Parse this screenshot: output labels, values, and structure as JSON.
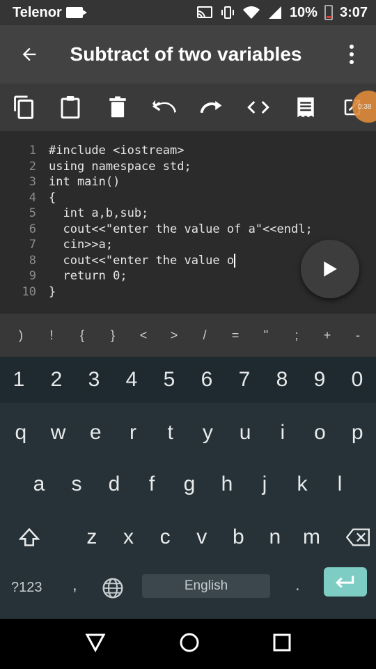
{
  "status_bar": {
    "carrier": "Telenor",
    "battery": "10%",
    "time": "3:07"
  },
  "app_bar": {
    "title": "Subtract of two variables"
  },
  "toolbar": {
    "icons": [
      "copy-icon",
      "paste-icon",
      "delete-icon",
      "undo-icon",
      "redo-icon",
      "code-icon",
      "format-icon",
      "open-external-icon"
    ],
    "overlay_badge": "0:38"
  },
  "editor": {
    "lines": [
      {
        "num": "1",
        "code": "#include <iostream>"
      },
      {
        "num": "2",
        "code": "using namespace std;"
      },
      {
        "num": "3",
        "code": "int main()"
      },
      {
        "num": "4",
        "code": "{"
      },
      {
        "num": "5",
        "code": "  int a,b,sub;"
      },
      {
        "num": "6",
        "code": "  cout<<\"enter the value of a\"<<endl;"
      },
      {
        "num": "7",
        "code": "  cin>>a;"
      },
      {
        "num": "8",
        "code": "  cout<<\"enter the value o"
      },
      {
        "num": "9",
        "code": "  return 0;"
      },
      {
        "num": "10",
        "code": "}"
      }
    ]
  },
  "symbols": [
    ")",
    "!",
    "{",
    "}",
    "<",
    ">",
    "/",
    "=",
    "\"",
    ";",
    "+",
    "-"
  ],
  "keyboard": {
    "numbers": [
      "1",
      "2",
      "3",
      "4",
      "5",
      "6",
      "7",
      "8",
      "9",
      "0"
    ],
    "row1": [
      "q",
      "w",
      "e",
      "r",
      "t",
      "y",
      "u",
      "i",
      "o",
      "p"
    ],
    "row2": [
      "a",
      "s",
      "d",
      "f",
      "g",
      "h",
      "j",
      "k",
      "l"
    ],
    "row3": [
      "z",
      "x",
      "c",
      "v",
      "b",
      "n",
      "m"
    ],
    "sym_label": "?123",
    "comma": ",",
    "space_label": "English",
    "period": "."
  }
}
